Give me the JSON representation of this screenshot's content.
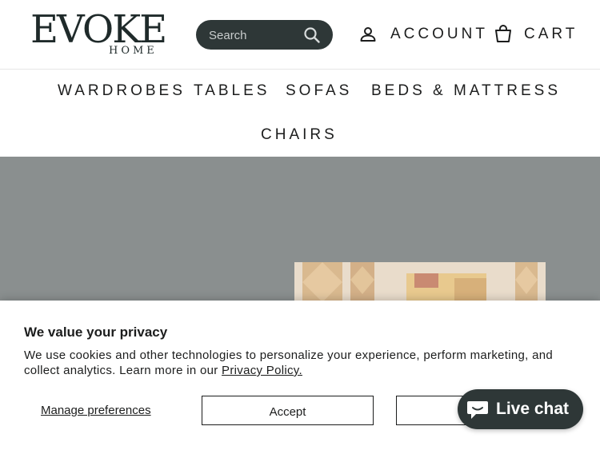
{
  "header": {
    "logo_main": "EVOKE",
    "logo_sub": "HOME",
    "search_placeholder": "Search",
    "account_label": "ACCOUNT",
    "cart_label": "CART"
  },
  "nav": {
    "items": [
      "WARDROBES",
      "TABLES",
      "SOFAS",
      "BEDS & MATTRESS",
      "CHAIRS"
    ]
  },
  "cookie": {
    "title": "We value your privacy",
    "text": "We use cookies and other technologies to personalize your experience, perform marketing, and collect analytics. Learn more in our",
    "privacy_link": "Privacy Policy.",
    "manage_label": "Manage preferences",
    "accept_label": "Accept",
    "decline_label": ""
  },
  "chat": {
    "label": "Live chat"
  },
  "colors": {
    "dark": "#2e3737",
    "hero_bg": "#8a8f8f"
  }
}
